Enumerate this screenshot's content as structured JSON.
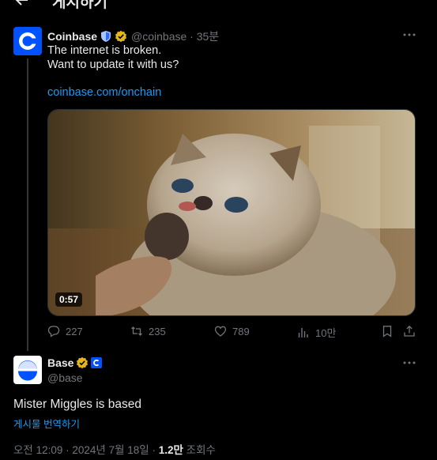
{
  "header": {
    "title": "게시하기"
  },
  "tweet1": {
    "name": "Coinbase",
    "handle": "@coinbase",
    "time": "35분",
    "line1": "The internet is broken.",
    "line2": "Want to update it with us?",
    "link": "coinbase.com/onchain",
    "video_duration": "0:57",
    "stats": {
      "replies": "227",
      "reposts": "235",
      "likes": "789",
      "views": "10만"
    }
  },
  "tweet2": {
    "name": "Base",
    "handle": "@base",
    "text": "Mister Miggles is based",
    "translate": "게시물 번역하기",
    "time": "오전 12:09",
    "date": "2024년 7월 18일",
    "views_count": "1.2만",
    "views_label": "조회수"
  },
  "colors": {
    "background": "#000000",
    "text": "#e7e9ea",
    "muted": "#71767b",
    "link": "#1d9bf0",
    "coinbase_blue": "#0052ff",
    "gold_badge": "#e2b719"
  },
  "icons": [
    "back-arrow-icon",
    "coinbase-logo",
    "shield-icon",
    "verified-gold-icon",
    "more-icon",
    "reply-icon",
    "repost-icon",
    "like-icon",
    "views-icon",
    "bookmark-icon",
    "share-icon",
    "base-logo",
    "coinbase-affiliate-icon"
  ]
}
